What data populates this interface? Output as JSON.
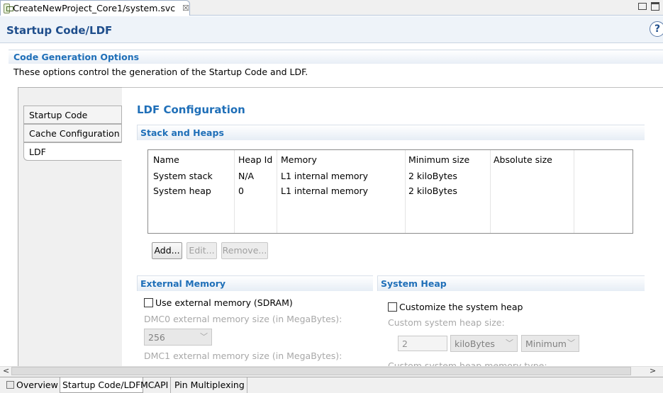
{
  "editor_tab": {
    "title": "CreateNewProject_Core1/system.svc",
    "close": "☒"
  },
  "page": {
    "title": "Startup Code/LDF",
    "help": "?"
  },
  "code_generation": {
    "title": "Code Generation Options",
    "description": "These options control the generation of the Startup Code and LDF."
  },
  "nav": {
    "items": [
      "Startup Code",
      "Cache Configuration",
      "LDF"
    ],
    "selected": "LDF"
  },
  "ldf": {
    "title": "LDF Configuration",
    "stack_heaps": {
      "title": "Stack and Heaps",
      "columns": [
        "Name",
        "Heap Id",
        "Memory",
        "Minimum size",
        "Absolute size"
      ],
      "rows": [
        [
          "System stack",
          "N/A",
          "L1 internal memory",
          "2 kiloBytes",
          ""
        ],
        [
          "System heap",
          "0",
          "L1 internal memory",
          "2 kiloBytes",
          ""
        ]
      ],
      "buttons": {
        "add": "Add...",
        "edit": "Edit...",
        "remove": "Remove..."
      }
    },
    "external_memory": {
      "title": "External Memory",
      "use_sdram_label": "Use external memory (SDRAM)",
      "use_sdram_checked": false,
      "dmc0_label": "DMC0 external memory size (in MegaBytes):",
      "dmc0_value": "256",
      "dmc1_label": "DMC1 external memory size (in MegaBytes):"
    },
    "system_heap": {
      "title": "System Heap",
      "customize_label": "Customize the system heap",
      "customize_checked": false,
      "size_label": "Custom system heap size:",
      "size_value": "2",
      "unit_value": "kiloBytes",
      "mode_value": "Minimum",
      "memory_type_label": "Custom system heap memory type:"
    }
  },
  "scrollbar": {
    "left": "<",
    "right": ">"
  },
  "bottom_tabs": [
    "Overview",
    "Startup Code/LDF",
    "MCAPI",
    "Pin Multiplexing"
  ],
  "active_bottom_tab": "Startup Code/LDF",
  "colors": {
    "accent": "#1f6fb8",
    "title": "#1f4e8c"
  }
}
